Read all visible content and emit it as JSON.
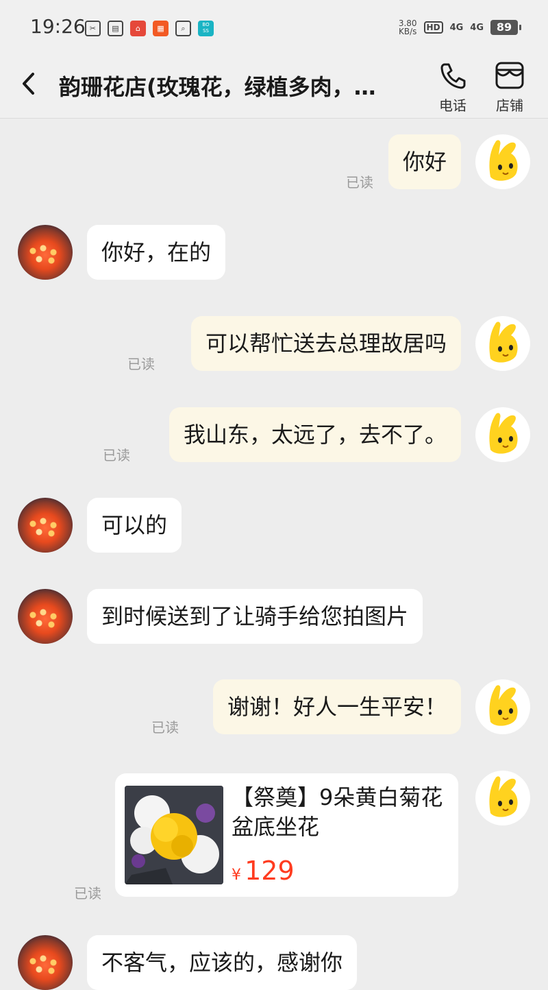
{
  "status_bar": {
    "time": "19:26",
    "speed": "3.80",
    "speed_unit": "KB/s",
    "hd": "HD",
    "network1": "4G",
    "network2": "4G",
    "battery": "89"
  },
  "header": {
    "title": "韵珊花店(玫瑰花，绿植多肉，…",
    "phone_label": "电话",
    "store_label": "店铺"
  },
  "messages": [
    {
      "sender": "me",
      "text": "你好",
      "status": "已读"
    },
    {
      "sender": "shop",
      "text": "你好，在的"
    },
    {
      "sender": "me",
      "text": "可以帮忙送去总理故居吗",
      "status": "已读"
    },
    {
      "sender": "me",
      "text": "我山东，太远了，去不了。",
      "status": "已读"
    },
    {
      "sender": "shop",
      "text": "可以的"
    },
    {
      "sender": "shop",
      "text": "到时候送到了让骑手给您拍图片"
    },
    {
      "sender": "me",
      "text": "谢谢！好人一生平安！",
      "status": "已读"
    },
    {
      "sender": "shop",
      "text": "不客气，应该的，感谢你"
    }
  ],
  "product_card": {
    "title": "【祭奠】9朵黄白菊花盆底坐花",
    "currency": "¥",
    "price": "129",
    "status": "已读"
  },
  "colors": {
    "background": "#ededed",
    "my_bubble": "#fcf7e6",
    "shop_bubble": "#ffffff",
    "price": "#ff3b1f"
  }
}
